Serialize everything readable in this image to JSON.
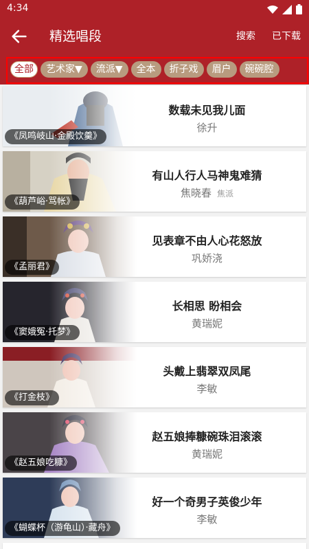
{
  "status_bar": {
    "time": "4:34"
  },
  "app_bar": {
    "title": "精选唱段",
    "search_label": "搜索",
    "downloaded_label": "已下载"
  },
  "filters": [
    "全部",
    "艺术家▼",
    "流派▼",
    "全本",
    "折子戏",
    "眉户",
    "碗碗腔"
  ],
  "active_filter": "全部",
  "colors": {
    "primary": "#ae2128",
    "chip": "#b89b7f",
    "highlight_box": "#ff0000"
  },
  "items": [
    {
      "caption": "《凤鸣岐山·金殿饮羹》",
      "title": "数载未见我儿面",
      "performer": "徐升",
      "school": ""
    },
    {
      "caption": "《葫芦峪·骂帐》",
      "title": "有山人行人马神鬼难猜",
      "performer": "焦晓春",
      "school": "焦派"
    },
    {
      "caption": "《孟丽君》",
      "title": "见表章不由人心花怒放",
      "performer": "巩娇浇",
      "school": ""
    },
    {
      "caption": "《窦娥冤·托梦》",
      "title": "长相思 盼相会",
      "performer": "黄瑞妮",
      "school": ""
    },
    {
      "caption": "《打金枝》",
      "title": "头戴上翡翠双凤尾",
      "performer": "李敏",
      "school": ""
    },
    {
      "caption": "《赵五娘吃糠》",
      "title": "赵五娘捧糠碗珠泪滚滚",
      "performer": "黄瑞妮",
      "school": ""
    },
    {
      "caption": "《蝴蝶杯（游龟山）·藏舟》",
      "title": "好一个奇男子英俊少年",
      "performer": "李敏",
      "school": ""
    }
  ]
}
